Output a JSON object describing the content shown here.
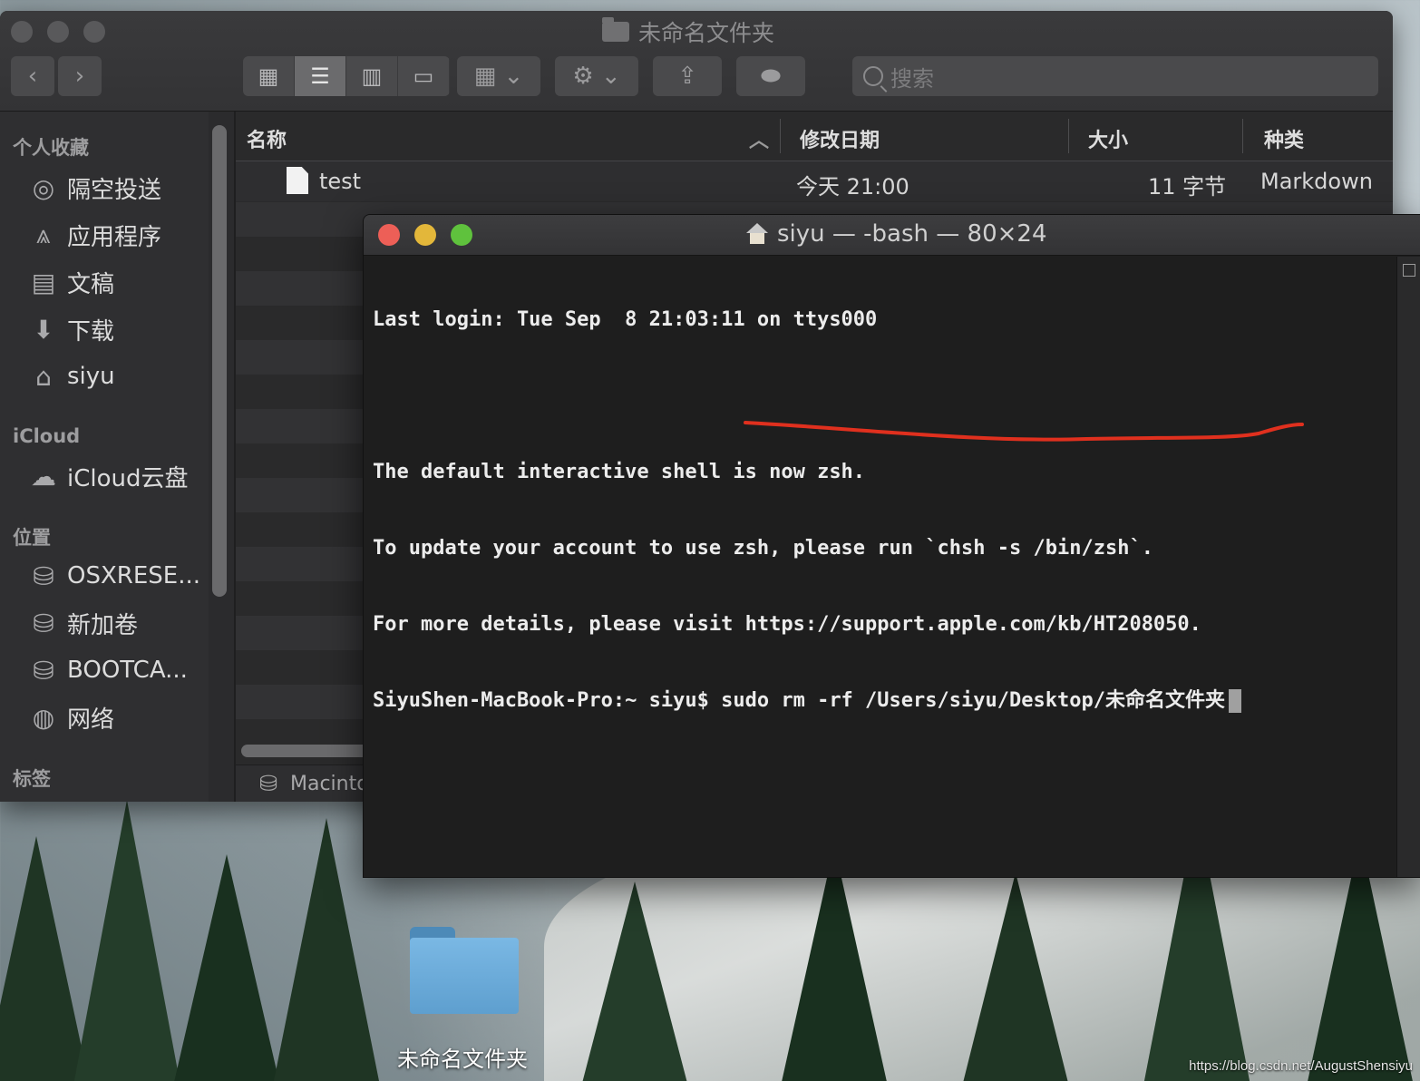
{
  "finder": {
    "title": "未命名文件夹",
    "search_placeholder": "搜索",
    "sidebar": {
      "favorites_header": "个人收藏",
      "favorites": [
        {
          "label": "隔空投送",
          "icon": "airdrop-icon"
        },
        {
          "label": "应用程序",
          "icon": "applications-icon"
        },
        {
          "label": "文稿",
          "icon": "documents-icon"
        },
        {
          "label": "下载",
          "icon": "downloads-icon"
        },
        {
          "label": "siyu",
          "icon": "home-icon"
        }
      ],
      "icloud_header": "iCloud",
      "icloud": [
        {
          "label": "iCloud云盘",
          "icon": "cloud-icon"
        }
      ],
      "locations_header": "位置",
      "locations": [
        {
          "label": "OSXRESE...",
          "icon": "disk-icon"
        },
        {
          "label": "新加卷",
          "icon": "disk-icon"
        },
        {
          "label": "BOOTCA...",
          "icon": "disk-icon"
        },
        {
          "label": "网络",
          "icon": "network-icon"
        }
      ],
      "tags_header": "标签"
    },
    "columns": {
      "name": "名称",
      "modified": "修改日期",
      "size": "大小",
      "kind": "种类"
    },
    "files": [
      {
        "name": "test",
        "modified": "今天 21:00",
        "size": "11 字节",
        "kind": "Markdown"
      }
    ],
    "path_bar": "Macinto"
  },
  "terminal": {
    "title": "siyu — -bash — 80×24",
    "lines": [
      "Last login: Tue Sep  8 21:03:11 on ttys000",
      "",
      "The default interactive shell is now zsh.",
      "To update your account to use zsh, please run `chsh -s /bin/zsh`.",
      "For more details, please visit https://support.apple.com/kb/HT208050.",
      "SiyuShen-MacBook-Pro:~ siyu$ sudo rm -rf /Users/siyu/Desktop/未命名文件夹"
    ],
    "annotation_color": "#e0301e"
  },
  "desktop": {
    "folder_label": "未命名文件夹",
    "watermark": "https://blog.csdn.net/AugustShensiyu"
  },
  "colors": {
    "close": "#ed5f57",
    "minimize": "#e3b73a",
    "zoom": "#5fc23d"
  }
}
